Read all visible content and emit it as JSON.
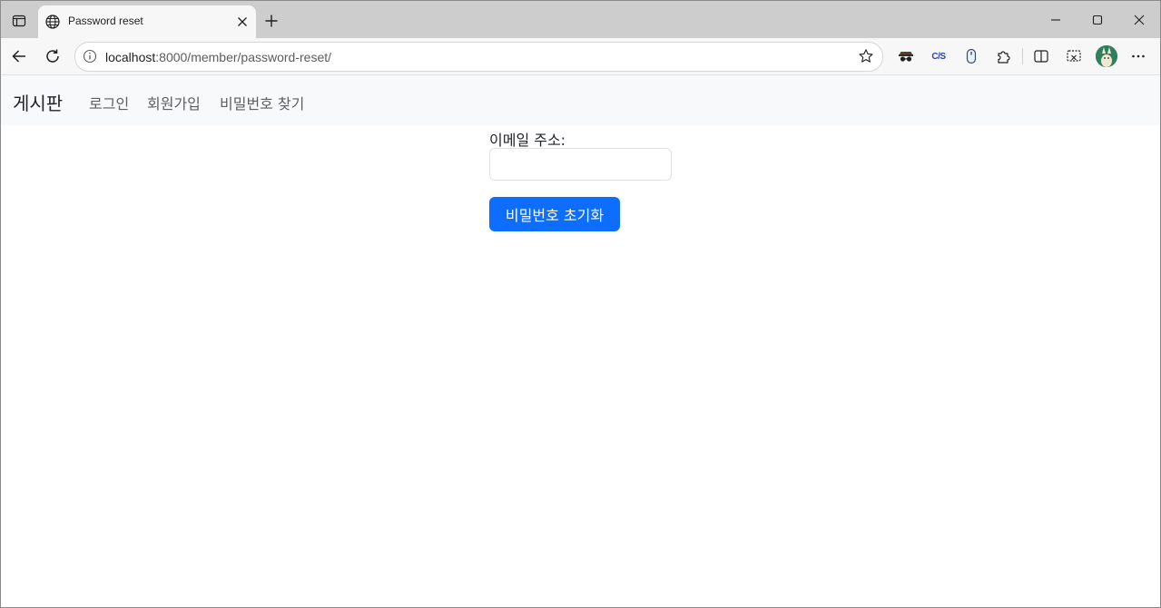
{
  "browser": {
    "tab": {
      "title": "Password reset",
      "favicon_icon": "globe-icon"
    },
    "address_bar": {
      "host": "localhost",
      "path": ":8000/member/password-reset/"
    },
    "icons": {
      "tab_actions": "tab-actions-icon",
      "close_tab": "close-icon",
      "new_tab": "plus-icon",
      "minimize": "minimize-icon",
      "maximize": "maximize-icon",
      "close_window": "close-icon",
      "back": "back-arrow-icon",
      "refresh": "refresh-icon",
      "site_info": "info-icon",
      "favorite": "star-icon",
      "extensions": [
        "incognito-mask-icon",
        "css-extension-icon",
        "mouse-extension-icon",
        "puzzle-icon"
      ],
      "split_screen": "split-screen-icon",
      "screenshot": "screenshot-icon",
      "more": "more-icon"
    },
    "extension_labels": {
      "css": "C/S"
    }
  },
  "navbar": {
    "brand": "게시판",
    "links": [
      {
        "label": "로그인"
      },
      {
        "label": "회원가입"
      },
      {
        "label": "비밀번호 찾기"
      }
    ]
  },
  "form": {
    "email_label": "이메일 주소:",
    "email_value": "",
    "submit_label": "비밀번호 초기화"
  },
  "colors": {
    "primary_button": "#0d6efd",
    "navbar_bg": "#f8f9fa",
    "tabstrip_bg": "#cdcdcd"
  }
}
